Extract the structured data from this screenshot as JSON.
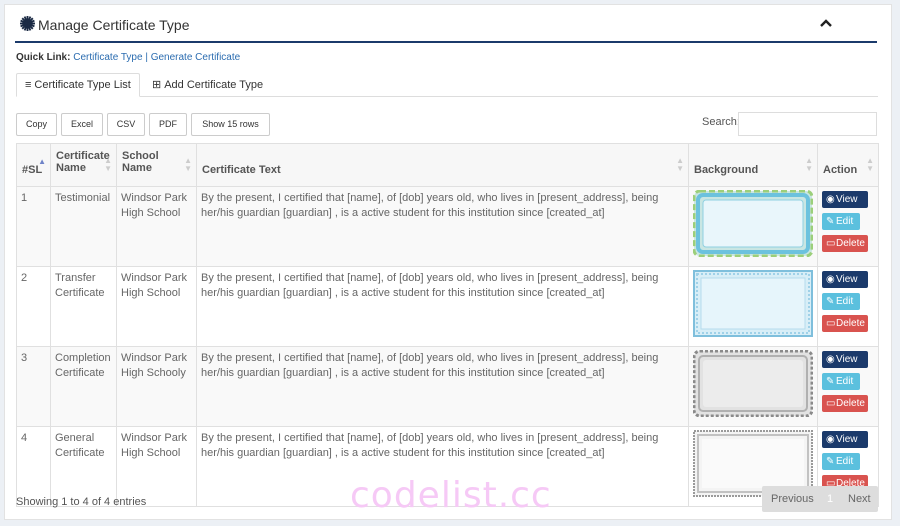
{
  "header": {
    "title": "Manage Certificate Type",
    "icon": "gear-icon",
    "collapse_icon": "chevron-up-icon"
  },
  "quick_link": {
    "label": "Quick Link:",
    "links": [
      "Certificate Type",
      "Generate Certificate"
    ],
    "separator": "|"
  },
  "tabs": [
    {
      "label": "Certificate Type List",
      "icon": "list-icon",
      "active": true
    },
    {
      "label": "Add Certificate Type",
      "icon": "plus-square-icon",
      "active": false
    }
  ],
  "toolbar": {
    "buttons": [
      "Copy",
      "Excel",
      "CSV",
      "PDF",
      "Show 15 rows"
    ],
    "search_label": "Search:",
    "search_value": ""
  },
  "table": {
    "columns": [
      "#SL",
      "Certificate Name",
      "School Name",
      "Certificate Text",
      "Background",
      "Action"
    ],
    "rows": [
      {
        "sl": "1",
        "name": "Testimonial",
        "school": "Windsor Park High School",
        "text": "By the present, I certified that [name], of [dob] years old, who lives in [present_address], being her/his guardian [guardian] , is a active student for this institution since [created_at]",
        "background": "green-blue-wave-border"
      },
      {
        "sl": "2",
        "name": "Transfer Certificate",
        "school": "Windsor Park High School",
        "text": "By the present, I certified that [name], of [dob] years old, who lives in [present_address], being her/his guardian [guardian] , is a active student for this institution since [created_at]",
        "background": "light-blue-zigzag-border"
      },
      {
        "sl": "3",
        "name": "Completion Certificate",
        "school": "Windsor Park High Schooly",
        "text": "By the present, I certified that [name], of [dob] years old, who lives in [present_address], being her/his guardian [guardian] , is a active student for this institution since [created_at]",
        "background": "gray-guilloche-border"
      },
      {
        "sl": "4",
        "name": "General Certificate",
        "school": "Windsor Park High School",
        "text": "By the present, I certified that [name], of [dob] years old, who lives in [present_address], being her/his guardian [guardian] , is a active student for this institution since [created_at]",
        "background": "gray-fine-border"
      }
    ],
    "actions": {
      "view": "View",
      "edit": "Edit",
      "delete": "Delete"
    }
  },
  "footer": {
    "info": "Showing 1 to 4 of 4 entries",
    "prev": "Previous",
    "page": "1",
    "next": "Next"
  },
  "watermark": "codelist.cc",
  "colors": {
    "primary": "#1b3a6b",
    "info": "#5bc0de",
    "danger": "#d9534f",
    "link": "#2b6cb0"
  }
}
